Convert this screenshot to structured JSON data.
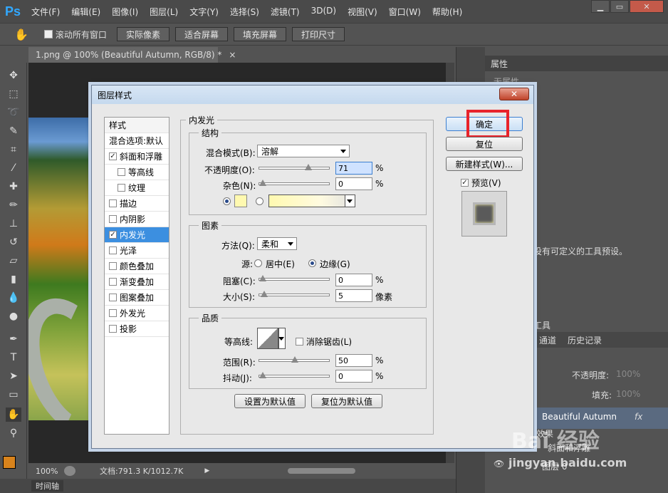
{
  "app": {
    "logo": "Ps"
  },
  "menu": [
    "文件(F)",
    "编辑(E)",
    "图像(I)",
    "图层(L)",
    "文字(Y)",
    "选择(S)",
    "滤镜(T)",
    "3D(D)",
    "视图(V)",
    "窗口(W)",
    "帮助(H)"
  ],
  "options": {
    "scroll_all": "滚动所有窗口",
    "actual_pixels": "实际像素",
    "fit_screen": "适合屏幕",
    "fill_screen": "填充屏幕",
    "print_size": "打印尺寸"
  },
  "document": {
    "tab": "1.png @ 100% (Beautiful Autumn, RGB/8) *",
    "zoom": "100%",
    "doc_size": "文档:791.3 K/1012.7K"
  },
  "bottom": {
    "timeline": "时间轴"
  },
  "right_panel": {
    "properties_tab": "属性",
    "no_properties": "无属性",
    "tool_preset_text": "没有可定义的工具预设。",
    "tool_label": "工具",
    "channels_tab": "通道",
    "history_tab": "历史记录",
    "opacity_label": "不透明度:",
    "opacity_value": "100%",
    "fill_label": "填充:",
    "fill_value": "100%",
    "layer_name": "Beautiful Autumn",
    "effects_label": "效果",
    "bevel_effect": "斜面和浮雕",
    "layer0": "图层 0"
  },
  "dialog": {
    "title": "图层样式",
    "styles_header": "样式",
    "blend_options": "混合选项:默认",
    "items": [
      {
        "label": "斜面和浮雕",
        "checked": true
      },
      {
        "label": "等高线",
        "checked": false
      },
      {
        "label": "纹理",
        "checked": false
      },
      {
        "label": "描边",
        "checked": false
      },
      {
        "label": "内阴影",
        "checked": false
      },
      {
        "label": "内发光",
        "checked": true
      },
      {
        "label": "光泽",
        "checked": false
      },
      {
        "label": "颜色叠加",
        "checked": false
      },
      {
        "label": "渐变叠加",
        "checked": false
      },
      {
        "label": "图案叠加",
        "checked": false
      },
      {
        "label": "外发光",
        "checked": false
      },
      {
        "label": "投影",
        "checked": false
      }
    ],
    "section_title": "内发光",
    "structure": {
      "title": "结构",
      "blend_mode_label": "混合模式(B):",
      "blend_mode_value": "溶解",
      "opacity_label": "不透明度(O):",
      "opacity_value": "71",
      "noise_label": "杂色(N):",
      "noise_value": "0",
      "glow_color": "#fff9b0",
      "percent": "%"
    },
    "elements": {
      "title": "图素",
      "method_label": "方法(Q):",
      "method_value": "柔和",
      "source_label": "源:",
      "source_center": "居中(E)",
      "source_edge": "边缘(G)",
      "choke_label": "阻塞(C):",
      "choke_value": "0",
      "size_label": "大小(S):",
      "size_value": "5",
      "px_unit": "像素"
    },
    "quality": {
      "title": "品质",
      "contour_label": "等高线:",
      "antialias_label": "消除锯齿(L)",
      "range_label": "范围(R):",
      "range_value": "50",
      "jitter_label": "抖动(J):",
      "jitter_value": "0"
    },
    "set_default": "设置为默认值",
    "reset_default": "复位为默认值",
    "ok": "确定",
    "reset": "复位",
    "new_style": "新建样式(W)...",
    "preview": "预览(V)"
  },
  "watermark": {
    "brand": "Bai 经验",
    "url": "jingyan.baidu.com"
  },
  "colors": {
    "highlight_box": "#e8232b",
    "selected_item": "#3c8fe0",
    "ps_blue": "#31a8ff"
  }
}
